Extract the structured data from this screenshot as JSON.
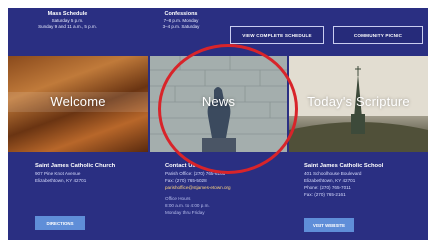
{
  "topbar": {
    "mass": {
      "heading": "Mass Schedule",
      "line1": "Saturday 5 p.m.",
      "line2": "Sunday 9 and 11 a.m., 5 p.m."
    },
    "confession": {
      "heading": "Confessions",
      "line1": "7–8 p.m. Monday",
      "line2": "3–4 p.m. Saturday"
    },
    "buttons": {
      "schedule": "VIEW COMPLETE SCHEDULE",
      "picnic": "COMMUNITY PICNIC"
    }
  },
  "tiles": [
    {
      "label": "Welcome"
    },
    {
      "label": "News"
    },
    {
      "label": "Today's Scripture"
    }
  ],
  "church": {
    "title": "Saint James Catholic Church",
    "addr1": "907 Pine Knot Avenue",
    "addr2": "Elizabethtown, KY 42701",
    "button": "DIRECTIONS"
  },
  "contact": {
    "title": "Contact Us",
    "office": "Parish Office: (270) 765-6166",
    "fax": "Fax: (270) 765-5028",
    "email": "parishoffice@stjames-etown.org",
    "hours_title": "Office Hours",
    "hours1": "8:00 a.m. to 4:00 p.m.",
    "hours2": "Monday thru Friday"
  },
  "school": {
    "title": "Saint James Catholic School",
    "addr1": "401 Schoolhouse Boulevard",
    "addr2": "Elizabethtown, KY 42701",
    "phone": "Phone: (270) 765-7011",
    "fax": "Fax: (270) 765-2161",
    "button": "VISIT WEBSITE"
  },
  "colors": {
    "background": "#2a2f82",
    "highlight_ring": "#d8242a",
    "button": "#5f8ed8"
  }
}
